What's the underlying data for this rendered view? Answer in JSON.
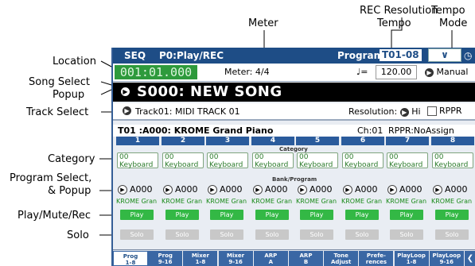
{
  "callouts": {
    "meter": "Meter",
    "rec_res_1": "REC Resolution",
    "rec_res_2": "Tempo",
    "tempo_mode_1": "Tempo",
    "tempo_mode_2": "Mode",
    "location": "Location",
    "song_select_1": "Song Select",
    "song_select_2": "Popup",
    "track_select": "Track Select",
    "category": "Category",
    "prog_select_1": "Program Select,",
    "prog_select_2": "& Popup",
    "play_mute_rec": "Play/Mute/Rec",
    "solo": "Solo"
  },
  "header": {
    "mode": "SEQ",
    "page": "P0:Play/REC",
    "program_label": "Program",
    "program_num": "T01-08",
    "menu_icon": "chevron-down-icon",
    "clock_icon": "clock-icon"
  },
  "location": "001:01.000",
  "meter_label": "Meter:",
  "meter_value": "4/4",
  "tempo_note": "♩=",
  "tempo_value": "120.00",
  "tempo_mode": "Manual",
  "song": "S000: NEW SONG",
  "track": "Track01: MIDI TRACK 01",
  "resolution_label": "Resolution:",
  "resolution_value": "Hi",
  "rppr_checkbox": "RPPR",
  "info": {
    "program": "T01 :A000: KROME Grand Piano",
    "channel": "Ch:01",
    "rppr": "RPPR:NoAssign"
  },
  "section_category": "Category",
  "section_bank": "Bank/Program",
  "tracks": [
    {
      "num": "1",
      "cat_num": "00",
      "cat_name": "Keyboard",
      "prog": "A000",
      "pname": "KROME Gran",
      "play": "Play",
      "solo": "Solo"
    },
    {
      "num": "2",
      "cat_num": "00",
      "cat_name": "Keyboard",
      "prog": "A000",
      "pname": "KROME Gran",
      "play": "Play",
      "solo": "Solo"
    },
    {
      "num": "3",
      "cat_num": "00",
      "cat_name": "Keyboard",
      "prog": "A000",
      "pname": "KROME Gran",
      "play": "Play",
      "solo": "Solo"
    },
    {
      "num": "4",
      "cat_num": "00",
      "cat_name": "Keyboard",
      "prog": "A000",
      "pname": "KROME Gran",
      "play": "Play",
      "solo": "Solo"
    },
    {
      "num": "5",
      "cat_num": "00",
      "cat_name": "Keyboard",
      "prog": "A000",
      "pname": "KROME Gran",
      "play": "Play",
      "solo": "Solo"
    },
    {
      "num": "6",
      "cat_num": "00",
      "cat_name": "Keyboard",
      "prog": "A000",
      "pname": "KROME Gran",
      "play": "Play",
      "solo": "Solo"
    },
    {
      "num": "7",
      "cat_num": "00",
      "cat_name": "Keyboard",
      "prog": "A000",
      "pname": "KROME Gran",
      "play": "Play",
      "solo": "Solo"
    },
    {
      "num": "8",
      "cat_num": "00",
      "cat_name": "Keyboard",
      "prog": "A000",
      "pname": "KROME Gran",
      "play": "Play",
      "solo": "Solo"
    }
  ],
  "tabs": [
    {
      "l1": "Prog",
      "l2": "1-8",
      "active": true
    },
    {
      "l1": "Prog",
      "l2": "9-16"
    },
    {
      "l1": "Mixer",
      "l2": "1-8"
    },
    {
      "l1": "Mixer",
      "l2": "9-16"
    },
    {
      "l1": "ARP",
      "l2": "A"
    },
    {
      "l1": "ARP",
      "l2": "B"
    },
    {
      "l1": "Tone",
      "l2": "Adjust"
    },
    {
      "l1": "Prefe-",
      "l2": "rences"
    },
    {
      "l1": "PlayLoop",
      "l2": "1-8"
    },
    {
      "l1": "PlayLoop",
      "l2": "9-16"
    }
  ],
  "colors": {
    "header": "#1e4d86",
    "location": "#2e9a3c",
    "play": "#33b845",
    "solo": "#c8c8c8",
    "tab": "#3a67a4"
  }
}
